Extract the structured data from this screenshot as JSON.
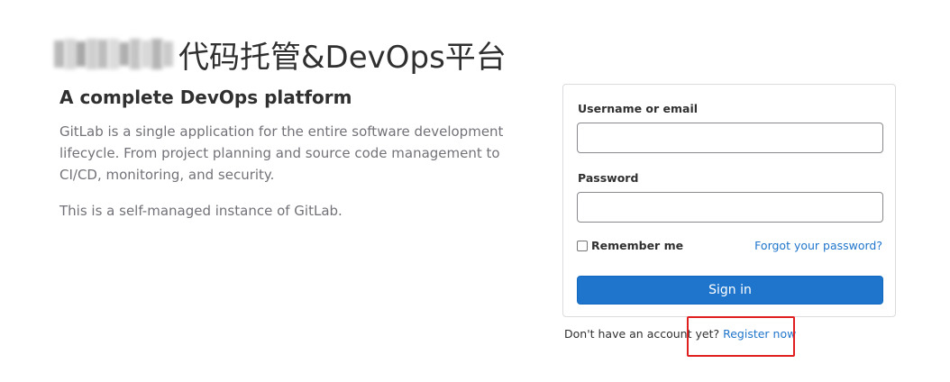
{
  "header": {
    "title": "代码托管&DevOps平台"
  },
  "intro": {
    "heading": "A complete DevOps platform",
    "paragraph1": "GitLab is a single application for the entire software development lifecycle. From project planning and source code management to CI/CD, monitoring, and security.",
    "paragraph2": "This is a self-managed instance of GitLab."
  },
  "login": {
    "username_label": "Username or email",
    "username_value": "",
    "password_label": "Password",
    "password_value": "",
    "remember_label": "Remember me",
    "remember_checked": false,
    "forgot_label": "Forgot your password?",
    "signin_label": "Sign in"
  },
  "register": {
    "prompt": "Don't have an account yet?",
    "link_label": "Register now"
  },
  "colors": {
    "accent": "#1f75cb",
    "highlight": "#e02020"
  }
}
